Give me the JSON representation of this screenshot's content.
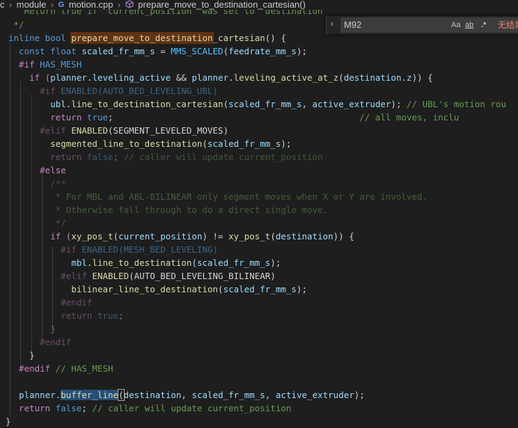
{
  "breadcrumb": {
    "root_fragment": "c",
    "folder": "module",
    "file": "motion.cpp",
    "file_icon": "G",
    "symbol": "prepare_move_to_destination_cartesian()",
    "separator": "›"
  },
  "find": {
    "query": "M92",
    "chevron": "›",
    "match_case": "Aa",
    "whole_word": "ab",
    "regex": ".*",
    "result": "无结果"
  },
  "code": {
    "l0": "   Return true if 'current_position' was set to 'destination'",
    "l1": " */",
    "l2_a": "inline bool ",
    "l2_b": "prepare_move_to_destination",
    "l2_c": "_cartesian",
    "l2_d": "() {",
    "l3_a": "  const float ",
    "l3_b": "scaled_fr_mm_s",
    "l3_c": " = ",
    "l3_d": "MMS_SCALED",
    "l3_e": "(",
    "l3_f": "feedrate_mm_s",
    "l3_g": ");",
    "l4_a": "  #if ",
    "l4_b": "HAS_MESH",
    "l5_a": "    if (",
    "l5_b": "planner",
    "l5_c": ".",
    "l5_d": "leveling_active",
    "l5_e": " && ",
    "l5_f": "planner",
    "l5_g": ".",
    "l5_h": "leveling_active_at_z",
    "l5_i": "(",
    "l5_j": "destination",
    "l5_k": ".",
    "l5_l": "z",
    "l5_m": ")) {",
    "l6_a": "      #if ",
    "l6_b": "ENABLED(AUTO_BED_LEVELING_UBL)",
    "l7_a": "        ",
    "l7_b": "ubl",
    "l7_c": ".",
    "l7_d": "line_to_destination_cartesian",
    "l7_e": "(",
    "l7_f": "scaled_fr_mm_s",
    "l7_g": ", ",
    "l7_h": "active_extruder",
    "l7_i": "); ",
    "l7_j": "// UBL's motion rou",
    "l8_a": "        return ",
    "l8_b": "true",
    "l8_c": ";",
    "l8_d": "                                               // all moves, inclu",
    "l9_a": "      #elif ",
    "l9_b": "ENABLED",
    "l9_c": "(",
    "l9_d": "SEGMENT_LEVELED_MOVES",
    "l9_e": ")",
    "l10_a": "        ",
    "l10_b": "segmented_line_to_destination",
    "l10_c": "(",
    "l10_d": "scaled_fr_mm_s",
    "l10_e": ");",
    "l11_a": "        return ",
    "l11_b": "false",
    "l11_c": "; ",
    "l11_d": "// caller will update current_position",
    "l12": "      #else",
    "l13": "        /**",
    "l14": "         * For MBL and ABL-BILINEAR only segment moves when X or Y are involved.",
    "l15": "         * Otherwise fall through to do a direct single move.",
    "l16": "         */",
    "l17_a": "        if (",
    "l17_b": "xy_pos_t",
    "l17_c": "(",
    "l17_d": "current_position",
    "l17_e": ") != ",
    "l17_f": "xy_pos_t",
    "l17_g": "(",
    "l17_h": "destination",
    "l17_i": ")) {",
    "l18_a": "          #if ",
    "l18_b": "ENABLED(MESH_BED_LEVELING)",
    "l19_a": "            ",
    "l19_b": "mbl",
    "l19_c": ".",
    "l19_d": "line_to_destination",
    "l19_e": "(",
    "l19_f": "scaled_fr_mm_s",
    "l19_g": ");",
    "l20_a": "          #elif ",
    "l20_b": "ENABLED",
    "l20_c": "(",
    "l20_d": "AUTO_BED_LEVELING_BILINEAR",
    "l20_e": ")",
    "l21_a": "            ",
    "l21_b": "bilinear_line_to_destination",
    "l21_c": "(",
    "l21_d": "scaled_fr_mm_s",
    "l21_e": ");",
    "l22": "          #endif",
    "l23_a": "          return ",
    "l23_b": "true",
    "l23_c": ";",
    "l24": "        }",
    "l25": "      #endif",
    "l26": "    }",
    "l27_a": "  #endif ",
    "l27_b": "// HAS_MESH",
    "l29_a": "  ",
    "l29_b": "planner",
    "l29_c": ".",
    "l29_d": "buffer_line",
    "l29_e": "(",
    "l29_f": "destination",
    "l29_g": ", ",
    "l29_h": "scaled_fr_mm_s",
    "l29_i": ", ",
    "l29_j": "active_extruder",
    "l29_k": ");",
    "l30_a": "  return ",
    "l30_b": "false",
    "l30_c": "; ",
    "l30_d": "// caller will update current_position",
    "l31": "}"
  }
}
